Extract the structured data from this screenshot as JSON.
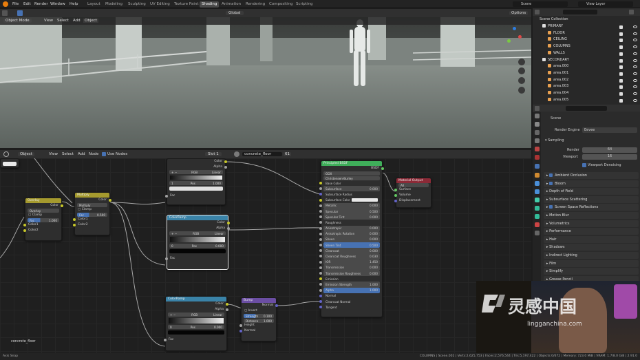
{
  "topbar": {
    "menus": [
      "File",
      "Edit",
      "Render",
      "Window",
      "Help"
    ],
    "workspaces": [
      "Layout",
      "Modeling",
      "Sculpting",
      "UV Editing",
      "Texture Paint",
      "Shading",
      "Animation",
      "Rendering",
      "Compositing",
      "Scripting"
    ],
    "active_workspace": "Shading",
    "scene": "Scene",
    "view_layer": "View Layer"
  },
  "viewport_header": {
    "mode": "Object Mode",
    "menus": [
      "View",
      "Select",
      "Add",
      "Object"
    ],
    "orientation": "Global",
    "options": "Options"
  },
  "node_header": {
    "object_type": "Object",
    "menus": [
      "View",
      "Select",
      "Add",
      "Node"
    ],
    "use_nodes": "Use Nodes",
    "slot": "Slot 1",
    "material": "concrete_floor",
    "users": "61"
  },
  "nodes": {
    "overlay": {
      "title": "Overlay",
      "out": "Color",
      "blend": "Overlay",
      "clamp": "Clamp",
      "fac_label": "Fac",
      "fac_val": "1.000",
      "in1": "Color1",
      "in2": "Color2"
    },
    "multiply": {
      "title": "Multiply",
      "out": "Color",
      "blend": "Multiply",
      "clamp": "Clamp",
      "fac_label": "Fac",
      "fac_val": "0.500",
      "in1": "Color1",
      "in2": "Color2"
    },
    "ramp1": {
      "color": "Color",
      "alpha": "Alpha",
      "mode": "RGB",
      "interp": "Linear",
      "pos_idx": "1",
      "pos_label": "Pos",
      "pos_val": "1.000",
      "fac": "Fac"
    },
    "ramp2": {
      "title": "ColorRamp",
      "color": "Color",
      "alpha": "Alpha",
      "mode": "RGB",
      "interp": "Linear",
      "pos_idx": "0",
      "pos_label": "Pos",
      "pos_val": "0.000",
      "fac": "Fac"
    },
    "ramp3": {
      "title": "ColorRamp",
      "color": "Color",
      "alpha": "Alpha",
      "mode": "RGB",
      "interp": "Linear",
      "pos_idx": "0",
      "pos_label": "Pos",
      "pos_val": "0.000",
      "fac": "Fac"
    },
    "bump": {
      "title": "Bump",
      "out": "Normal",
      "invert": "Invert",
      "strength_label": "Strength",
      "strength_val": "0.100",
      "distance_label": "Distance",
      "distance_val": "1.000",
      "height": "Height",
      "normal": "Normal"
    },
    "bsdf": {
      "title": "Principled BSDF",
      "out": "BSDF",
      "dist": "GGX",
      "sss": "Christensen-Burley",
      "rows": [
        {
          "label": "Base Color",
          "val": ""
        },
        {
          "label": "Subsurface",
          "val": "0.000"
        },
        {
          "label": "Subsurface Radius",
          "val": ""
        },
        {
          "label": "Subsurface Color",
          "val": ""
        },
        {
          "label": "Metallic",
          "val": "0.000"
        },
        {
          "label": "Specular",
          "val": "0.500"
        },
        {
          "label": "Specular Tint",
          "val": "0.000"
        },
        {
          "label": "Roughness",
          "val": ""
        },
        {
          "label": "Anisotropic",
          "val": "0.000"
        },
        {
          "label": "Anisotropic Rotation",
          "val": "0.000"
        },
        {
          "label": "Sheen",
          "val": "0.000"
        },
        {
          "label": "Sheen Tint",
          "val": "0.500"
        },
        {
          "label": "Clearcoat",
          "val": "0.000"
        },
        {
          "label": "Clearcoat Roughness",
          "val": "0.030"
        },
        {
          "label": "IOR",
          "val": "1.450"
        },
        {
          "label": "Transmission",
          "val": "0.000"
        },
        {
          "label": "Transmission Roughness",
          "val": "0.000"
        },
        {
          "label": "Emission",
          "val": ""
        },
        {
          "label": "Emission Strength",
          "val": "1.000"
        },
        {
          "label": "Alpha",
          "val": "1.000"
        },
        {
          "label": "Normal",
          "val": ""
        },
        {
          "label": "Clearcoat Normal",
          "val": ""
        },
        {
          "label": "Tangent",
          "val": ""
        }
      ]
    },
    "output": {
      "title": "Material Output",
      "target": "All",
      "surface": "Surface",
      "volume": "Volume",
      "displacement": "Displacement"
    }
  },
  "node_label": "concrete_floor",
  "outliner": {
    "title": "Scene Collection",
    "items": [
      {
        "name": "PRIMARY",
        "indent": 1
      },
      {
        "name": "FLOOR",
        "indent": 2
      },
      {
        "name": "CEILING",
        "indent": 2
      },
      {
        "name": "COLUMNS",
        "indent": 2
      },
      {
        "name": "WALLS",
        "indent": 2
      },
      {
        "name": "SECONDARY",
        "indent": 1
      },
      {
        "name": "area.000",
        "indent": 2
      },
      {
        "name": "area.001",
        "indent": 2
      },
      {
        "name": "area.002",
        "indent": 2
      },
      {
        "name": "area.003",
        "indent": 2
      },
      {
        "name": "area.004",
        "indent": 2
      },
      {
        "name": "area.005",
        "indent": 2
      }
    ]
  },
  "properties": {
    "scene": "Scene",
    "render_engine_label": "Render Engine",
    "render_engine": "Eevee",
    "sampling": "Sampling",
    "render_label": "Render",
    "render_val": "64",
    "viewport_label": "Viewport",
    "viewport_val": "16",
    "denoise": "Viewport Denoising",
    "panels": [
      "Ambient Occlusion",
      "Bloom",
      "Depth of Field",
      "Subsurface Scattering",
      "Screen Space Reflections",
      "Motion Blur",
      "Volumetrics",
      "Performance",
      "Hair",
      "Shadows",
      "Indirect Lighting",
      "Film",
      "Simplify",
      "Grease Pencil"
    ]
  },
  "status": {
    "left": "Axis Snap",
    "right": "COLUMNS | Scene.002 | Verts:2,625,753 | Faces:2,576,544 | Tris:5,197,422 | Objects:0/672 | Memory: 723.0 MiB | VRAM: 1.7/8.0 GiB | 2.91.0"
  },
  "watermark": {
    "cn": "灵感中国",
    "url": "lingganchina.com"
  },
  "colors": {
    "accent": "#4772b3",
    "selected": "#e8e8e8",
    "shader_header": "#3fae5a",
    "input_header": "#a59a2e",
    "converter_header": "#3a83a8",
    "vector_header": "#6b4ea3",
    "output_header": "#8c2a37"
  }
}
